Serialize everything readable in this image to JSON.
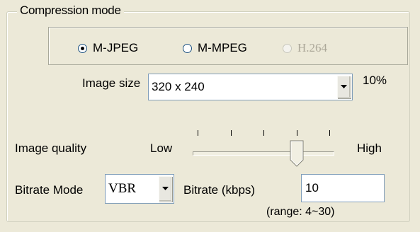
{
  "compression_mode": {
    "title": "Compression mode",
    "options": [
      {
        "label": "M-JPEG",
        "checked": true,
        "enabled": true
      },
      {
        "label": "M-MPEG",
        "checked": false,
        "enabled": true
      },
      {
        "label": "H.264",
        "checked": false,
        "enabled": false
      }
    ]
  },
  "image_size": {
    "label": "Image size",
    "value": "320 x 240",
    "percent": "10%"
  },
  "image_quality": {
    "label": "Image quality",
    "low_label": "Low",
    "high_label": "High",
    "level_fraction": 0.75
  },
  "bitrate": {
    "mode_label": "Bitrate Mode",
    "mode_value": "VBR",
    "kbps_label": "Bitrate (kbps)",
    "kbps_value": "10",
    "range_text": "(range: 4~30)"
  }
}
